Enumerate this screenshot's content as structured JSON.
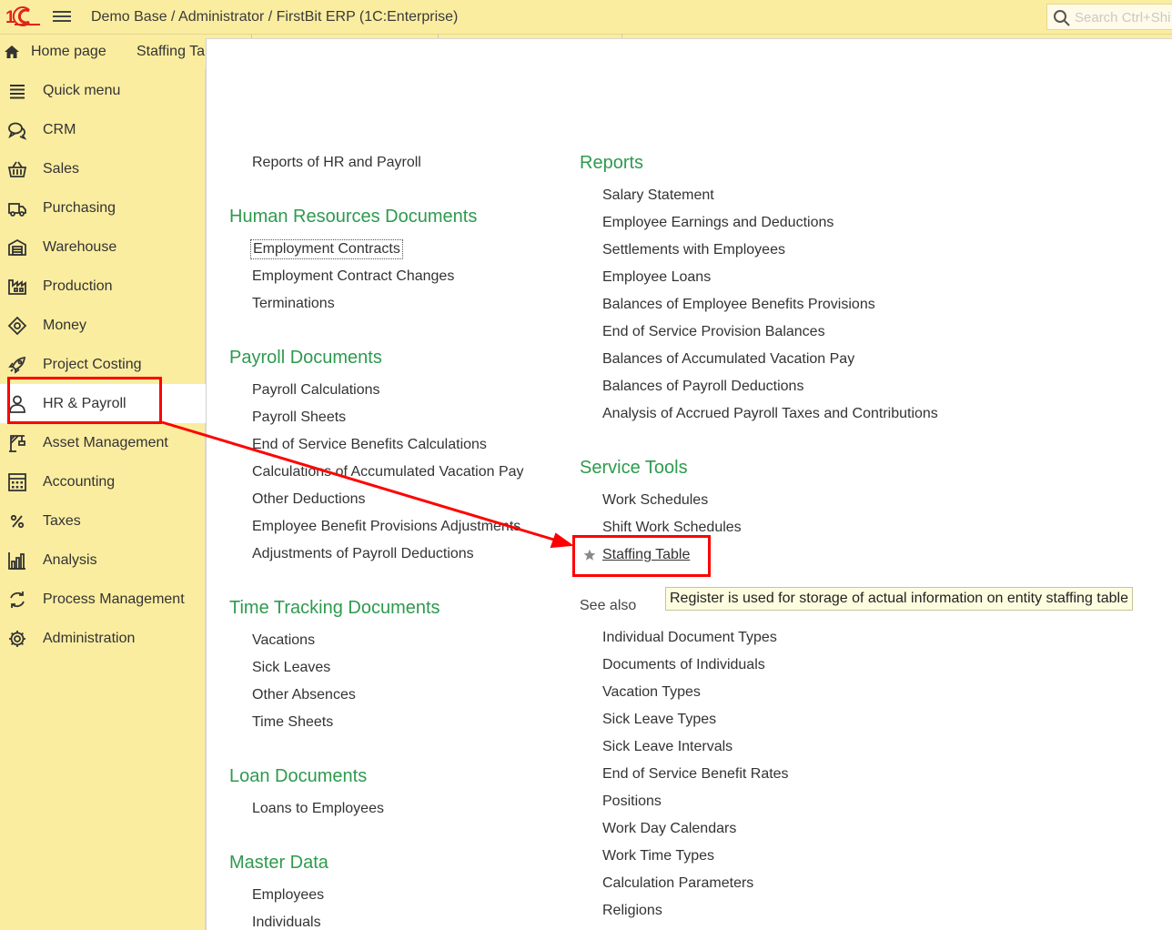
{
  "header": {
    "title": "Demo Base / Administrator / FirstBit ERP  (1C:Enterprise)",
    "search_placeholder": "Search Ctrl+Shift+F"
  },
  "tabs": [
    {
      "label": "Home page",
      "icon": "home-icon"
    },
    {
      "label": "Staffing Table"
    }
  ],
  "sidebar": {
    "items": [
      {
        "label": "Quick menu",
        "icon": "menu-lines-icon"
      },
      {
        "label": "CRM",
        "icon": "chat-bubbles-icon"
      },
      {
        "label": "Sales",
        "icon": "basket-icon"
      },
      {
        "label": "Purchasing",
        "icon": "truck-icon"
      },
      {
        "label": "Warehouse",
        "icon": "warehouse-icon"
      },
      {
        "label": "Production",
        "icon": "factory-icon"
      },
      {
        "label": "Money",
        "icon": "money-tag-icon"
      },
      {
        "label": "Project Costing",
        "icon": "rocket-icon"
      },
      {
        "label": "HR & Payroll",
        "icon": "person-icon",
        "active": true
      },
      {
        "label": "Asset Management",
        "icon": "crane-icon"
      },
      {
        "label": "Accounting",
        "icon": "calculator-icon"
      },
      {
        "label": "Taxes",
        "icon": "percent-icon"
      },
      {
        "label": "Analysis",
        "icon": "bar-chart-icon"
      },
      {
        "label": "Process Management",
        "icon": "process-cycle-icon"
      },
      {
        "label": "Administration",
        "icon": "gear-icon"
      }
    ]
  },
  "left_column": {
    "top_link": "Reports of HR and Payroll",
    "sections": [
      {
        "title": "Human Resources Documents",
        "items": [
          "Employment Contracts",
          "Employment Contract Changes",
          "Terminations"
        ]
      },
      {
        "title": "Payroll Documents",
        "items": [
          "Payroll Calculations",
          "Payroll Sheets",
          "End of Service Benefits Calculations",
          "Calculations of Accumulated Vacation Pay",
          "Other Deductions",
          "Employee Benefit Provisions Adjustments",
          "Adjustments of Payroll Deductions"
        ]
      },
      {
        "title": "Time Tracking Documents",
        "items": [
          "Vacations",
          "Sick Leaves",
          "Other Absences",
          "Time Sheets"
        ]
      },
      {
        "title": "Loan Documents",
        "items": [
          "Loans to Employees"
        ]
      },
      {
        "title": "Master Data",
        "items": [
          "Employees",
          "Individuals"
        ]
      }
    ]
  },
  "right_column": {
    "reports": {
      "title": "Reports",
      "items": [
        "Salary Statement",
        "Employee Earnings and Deductions",
        "Settlements with Employees",
        "Employee Loans",
        "Balances of Employee Benefits Provisions",
        "End of Service Provision Balances",
        "Balances of Accumulated Vacation Pay",
        "Balances of Payroll Deductions",
        "Analysis of Accrued Payroll Taxes and Contributions"
      ]
    },
    "service_tools": {
      "title": "Service Tools",
      "items": [
        "Work Schedules",
        "Shift Work Schedules",
        "Staffing Table"
      ]
    },
    "see_also": {
      "title": "See also",
      "items": [
        "Individual Document Types",
        "Documents of Individuals",
        "Vacation Types",
        "Sick Leave Types",
        "Sick Leave Intervals",
        "End of Service Benefit Rates",
        "Positions",
        "Work Day Calendars",
        "Work Time Types",
        "Calculation Parameters",
        "Religions"
      ]
    }
  },
  "tooltip": "Register is used for storage of actual information on entity staffing table",
  "colors": {
    "sidebar_bg": "#fbeda0",
    "section_title": "#2e9a4e",
    "annotation": "#ff0000"
  }
}
